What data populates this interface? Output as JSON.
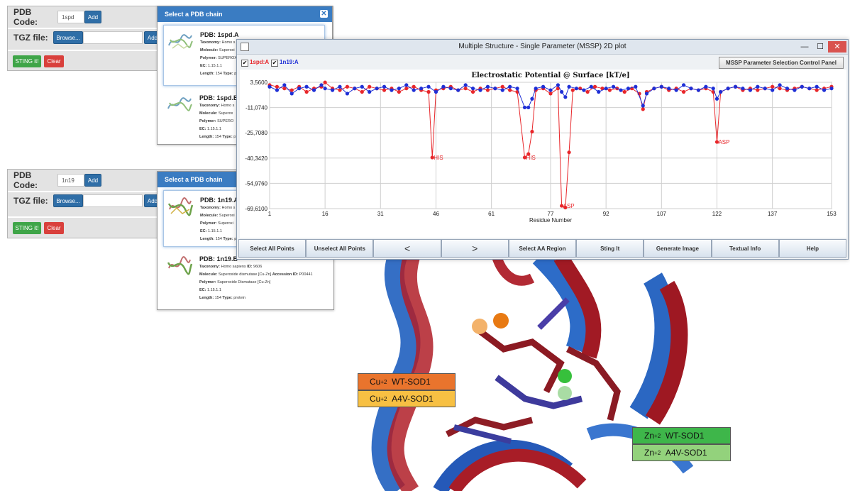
{
  "form1": {
    "pdb_label": "PDB Code:",
    "pdb_value": "1spd",
    "add_label": "Add",
    "tgz_label": "TGZ file:",
    "browse_label": "Browse...",
    "tgz_add_label": "Add",
    "sting_label": "STING it!",
    "clear_label": "Clear"
  },
  "form2": {
    "pdb_label": "PDB Code:",
    "pdb_value": "1n19",
    "add_label": "Add",
    "tgz_label": "TGZ file:",
    "browse_label": "Browse...",
    "tgz_add_label": "Add",
    "sting_label": "STING it!",
    "clear_label": "Clear"
  },
  "dialog1": {
    "title": "Select a PDB chain",
    "close": "✕",
    "chains": [
      {
        "title": "PDB: 1spd.A",
        "taxonomy_key": "Taxonomy:",
        "taxonomy": "Homo s",
        "molecule_key": "Molecule:",
        "molecule": "Superoxi",
        "polymer_key": "Polymer:",
        "polymer": "SUPEROX",
        "ec_key": "EC:",
        "ec": "1.15.1.1",
        "length_key": "Length:",
        "length": "154",
        "type_key": "Type:",
        "type": "p"
      },
      {
        "title": "PDB: 1spd.B",
        "taxonomy_key": "Taxonomy:",
        "taxonomy": "Homo s",
        "molecule_key": "Molecule:",
        "molecule": "Superox",
        "polymer_key": "Polymer:",
        "polymer": "SUPERO",
        "ec_key": "EC:",
        "ec": "1.15.1.1",
        "length_key": "Length:",
        "length": "154",
        "type_key": "Type:",
        "type": "p"
      }
    ]
  },
  "dialog2": {
    "title": "Select a PDB chain",
    "chains": [
      {
        "title": "PDB: 1n19.A",
        "taxonomy_key": "Taxonomy:",
        "taxonomy": "Homo s",
        "molecule_key": "Molecule:",
        "molecule": "Superoxi",
        "polymer_key": "Polymer:",
        "polymer": "Superoxi",
        "ec_key": "EC:",
        "ec": "1.15.1.1",
        "length_key": "Length:",
        "length": "154",
        "type_key": "Type:",
        "type": "p"
      },
      {
        "title": "PDB: 1n19.B",
        "taxonomy_key": "Taxonomy:",
        "taxonomy": "Homo sapiens",
        "id_key": "ID:",
        "id": "9606",
        "molecule_key": "Molecule:",
        "molecule": "Superoxide dismutase [Cu-Zn]",
        "accession_key": "Accession ID:",
        "accession": "P00441",
        "polymer_key": "Polymer:",
        "polymer": "Superoxide Dismutase [Cu-Zn]",
        "ec_key": "EC:",
        "ec": "1.15.1.1",
        "length_key": "Length:",
        "length": "154",
        "type_key": "Type:",
        "type": "protein"
      }
    ]
  },
  "window": {
    "title": "Multiple Structure - Single Parameter (MSSP) 2D plot",
    "minimize": "—",
    "maximize": "☐",
    "close": "✕",
    "series1_label": "1spd:A",
    "series2_label": "1n19:A",
    "check": "✔",
    "control_panel_button": "MSSP Parameter Selection Control Panel",
    "buttons": [
      "Select All Points",
      "Unselect All Points",
      "<",
      ">",
      "Select AA Region",
      "Sting It",
      "Generate Image",
      "Textual Info",
      "Help"
    ]
  },
  "colors": {
    "series1": "#e8262a",
    "series2": "#1e2fd6",
    "cu_wt": "#e8792e",
    "cu_a4v": "#f7c043",
    "zn_wt": "#3eb64a",
    "zn_a4v": "#93d27c"
  },
  "chart_data": {
    "type": "line",
    "title": "Electrostatic Potential @ Surface [kT/e]",
    "xlabel": "Residue Number",
    "ylabel": "",
    "xlim": [
      1,
      153
    ],
    "ylim": [
      -69.61,
      3.56
    ],
    "x_ticks": [
      "1",
      "16",
      "31",
      "46",
      "61",
      "77",
      "92",
      "107",
      "122",
      "137",
      "153"
    ],
    "y_ticks": [
      "3,5600",
      "-11,0740",
      "-25,7080",
      "-40,3420",
      "-54,9760",
      "-69,6100"
    ],
    "grid": true,
    "series": [
      {
        "name": "1spd:A",
        "color": "#e8262a",
        "points": [
          [
            1,
            2
          ],
          [
            3,
            1
          ],
          [
            5,
            0
          ],
          [
            7,
            -1
          ],
          [
            9,
            1
          ],
          [
            11,
            -2
          ],
          [
            13,
            0
          ],
          [
            15,
            1
          ],
          [
            16,
            3.5
          ],
          [
            18,
            0
          ],
          [
            20,
            -1
          ],
          [
            22,
            1
          ],
          [
            24,
            0
          ],
          [
            26,
            -2
          ],
          [
            28,
            1
          ],
          [
            30,
            0
          ],
          [
            32,
            -1
          ],
          [
            34,
            0
          ],
          [
            36,
            -2
          ],
          [
            38,
            0
          ],
          [
            40,
            1
          ],
          [
            42,
            -1
          ],
          [
            44,
            -2
          ],
          [
            45,
            -40
          ],
          [
            46,
            -1
          ],
          [
            48,
            0
          ],
          [
            50,
            1
          ],
          [
            52,
            -1
          ],
          [
            54,
            0
          ],
          [
            56,
            -2
          ],
          [
            58,
            0
          ],
          [
            60,
            -1
          ],
          [
            62,
            0
          ],
          [
            64,
            1
          ],
          [
            66,
            -1
          ],
          [
            68,
            -2
          ],
          [
            70,
            -40
          ],
          [
            71,
            -38
          ],
          [
            72,
            -25
          ],
          [
            73,
            -1
          ],
          [
            75,
            0
          ],
          [
            77,
            -3
          ],
          [
            79,
            0
          ],
          [
            80,
            -68
          ],
          [
            81,
            -69
          ],
          [
            82,
            -37
          ],
          [
            83,
            -1
          ],
          [
            85,
            0
          ],
          [
            87,
            -2
          ],
          [
            89,
            1
          ],
          [
            91,
            0
          ],
          [
            93,
            -1
          ],
          [
            95,
            0
          ],
          [
            97,
            -2
          ],
          [
            99,
            0
          ],
          [
            101,
            -3
          ],
          [
            102,
            -12
          ],
          [
            103,
            -2
          ],
          [
            105,
            0
          ],
          [
            107,
            1
          ],
          [
            109,
            -1
          ],
          [
            111,
            0
          ],
          [
            113,
            -2
          ],
          [
            115,
            0
          ],
          [
            117,
            -1
          ],
          [
            119,
            0
          ],
          [
            121,
            -2
          ],
          [
            122,
            -31
          ],
          [
            123,
            -2
          ],
          [
            125,
            0
          ],
          [
            127,
            1
          ],
          [
            129,
            -1
          ],
          [
            131,
            0
          ],
          [
            133,
            -1
          ],
          [
            135,
            0
          ],
          [
            137,
            1
          ],
          [
            139,
            0
          ],
          [
            141,
            -1
          ],
          [
            143,
            0
          ],
          [
            145,
            1
          ],
          [
            147,
            0
          ],
          [
            149,
            -1
          ],
          [
            151,
            0
          ],
          [
            153,
            1
          ]
        ]
      },
      {
        "name": "1n19:A",
        "color": "#1e2fd6",
        "points": [
          [
            1,
            1
          ],
          [
            3,
            -1
          ],
          [
            5,
            2
          ],
          [
            7,
            -3
          ],
          [
            9,
            0
          ],
          [
            11,
            1
          ],
          [
            13,
            -1
          ],
          [
            15,
            2
          ],
          [
            16,
            0
          ],
          [
            18,
            -1
          ],
          [
            20,
            1
          ],
          [
            22,
            -3
          ],
          [
            24,
            0
          ],
          [
            26,
            1
          ],
          [
            28,
            -2
          ],
          [
            30,
            0
          ],
          [
            32,
            1
          ],
          [
            34,
            -1
          ],
          [
            36,
            0
          ],
          [
            38,
            2
          ],
          [
            40,
            -1
          ],
          [
            42,
            0
          ],
          [
            44,
            1
          ],
          [
            46,
            -2
          ],
          [
            48,
            1
          ],
          [
            50,
            0
          ],
          [
            52,
            -1
          ],
          [
            54,
            2
          ],
          [
            56,
            0
          ],
          [
            58,
            -1
          ],
          [
            60,
            1
          ],
          [
            62,
            0
          ],
          [
            64,
            -1
          ],
          [
            66,
            1
          ],
          [
            68,
            0
          ],
          [
            70,
            -11
          ],
          [
            71,
            -11
          ],
          [
            72,
            -6
          ],
          [
            73,
            0
          ],
          [
            75,
            1
          ],
          [
            77,
            -1
          ],
          [
            79,
            2
          ],
          [
            80,
            -2
          ],
          [
            81,
            -5
          ],
          [
            82,
            1
          ],
          [
            84,
            0
          ],
          [
            86,
            -1
          ],
          [
            88,
            1
          ],
          [
            90,
            -2
          ],
          [
            92,
            0
          ],
          [
            94,
            1
          ],
          [
            96,
            -1
          ],
          [
            98,
            0
          ],
          [
            100,
            1
          ],
          [
            102,
            -10
          ],
          [
            103,
            -3
          ],
          [
            105,
            0
          ],
          [
            107,
            1
          ],
          [
            109,
            0
          ],
          [
            111,
            -1
          ],
          [
            113,
            2
          ],
          [
            115,
            0
          ],
          [
            117,
            -1
          ],
          [
            119,
            1
          ],
          [
            121,
            0
          ],
          [
            122,
            -6
          ],
          [
            123,
            -2
          ],
          [
            125,
            0
          ],
          [
            127,
            1
          ],
          [
            129,
            0
          ],
          [
            131,
            -1
          ],
          [
            133,
            1
          ],
          [
            135,
            0
          ],
          [
            137,
            -1
          ],
          [
            139,
            2
          ],
          [
            141,
            0
          ],
          [
            143,
            -1
          ],
          [
            145,
            1
          ],
          [
            147,
            0
          ],
          [
            149,
            1
          ],
          [
            151,
            -1
          ],
          [
            153,
            0
          ]
        ]
      }
    ],
    "annotations": [
      {
        "text": "HIS",
        "x": 45,
        "y": -40
      },
      {
        "text": "HIS",
        "x": 70,
        "y": -40
      },
      {
        "text": "ASP",
        "x": 80,
        "y": -68
      },
      {
        "text": "ASP",
        "x": 122,
        "y": -31
      }
    ]
  },
  "legends": {
    "cu_wt": {
      "ion": "Cu",
      "charge": "+2",
      "label": "WT-SOD1"
    },
    "cu_a4v": {
      "ion": "Cu",
      "charge": "+2",
      "label": "A4V-SOD1"
    },
    "zn_wt": {
      "ion": "Zn",
      "charge": "+2",
      "label": "WT-SOD1"
    },
    "zn_a4v": {
      "ion": "Zn",
      "charge": "+2",
      "label": "A4V-SOD1"
    }
  }
}
